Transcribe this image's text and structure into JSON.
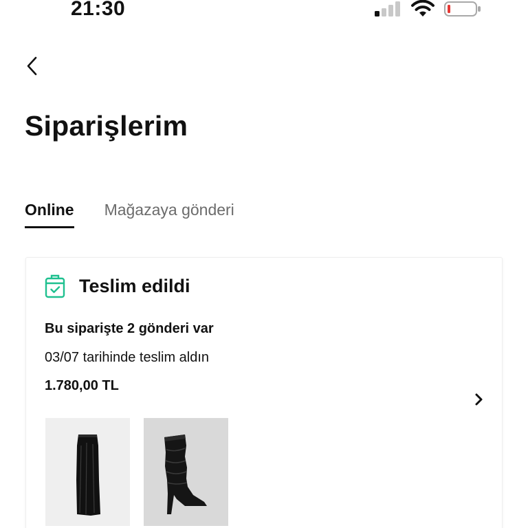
{
  "status_bar": {
    "time": "21:30"
  },
  "header": {
    "back_icon": "chevron-left-icon",
    "title": "Siparişlerim"
  },
  "tabs": [
    {
      "label": "Online",
      "active": true
    },
    {
      "label": "Mağazaya gönderi",
      "active": false
    }
  ],
  "order": {
    "status_icon": "delivered-box-icon",
    "status": "Teslim edildi",
    "status_color": "#1ec08f",
    "shipments_text": "Bu siparişte 2 gönderi var",
    "delivery_text": "03/07 tarihinde teslim aldın",
    "price": "1.780,00 TL",
    "products": [
      {
        "name": "skirt",
        "icon": "black-satin-skirt-image"
      },
      {
        "name": "boot",
        "icon": "black-slouch-boot-image"
      }
    ]
  }
}
